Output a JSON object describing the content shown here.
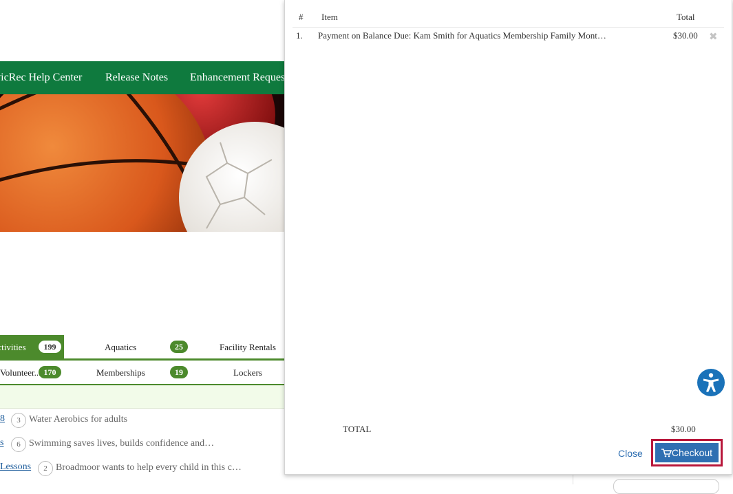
{
  "nav": {
    "items": [
      "CivicRec Help Center",
      "Release Notes",
      "Enhancement Requests"
    ]
  },
  "tabs": {
    "row1": [
      {
        "label": "Activities",
        "count": "199"
      },
      {
        "label": "Aquatics",
        "count": "25"
      },
      {
        "label": "Facility Rentals"
      }
    ],
    "row2": [
      {
        "label": "Volunteer...",
        "count": "170"
      },
      {
        "label": "Memberships",
        "count": "19"
      },
      {
        "label": "Lockers"
      }
    ]
  },
  "results": [
    {
      "link": "8",
      "count": "3",
      "desc": "Water Aerobics for adults"
    },
    {
      "link": "s",
      "count": "6",
      "desc": "Swimming saves lives, builds confidence and…"
    },
    {
      "link": "Lessons",
      "count": "2",
      "desc": "Broadmoor wants to help every child in this c…"
    }
  ],
  "cart": {
    "headers": {
      "num": "#",
      "item": "Item",
      "total": "Total"
    },
    "items": [
      {
        "num": "1.",
        "item": "Payment on Balance Due: Kam Smith for Aquatics Membership Family Mont…",
        "total": "$30.00"
      }
    ],
    "total_label": "TOTAL",
    "total_value": "$30.00",
    "close_label": "Close",
    "checkout_label": "Checkout"
  },
  "colors": {
    "nav_green": "#0f7a3e",
    "tab_green": "#4c8a2c",
    "primary_blue": "#2f6fb2",
    "focus_outline": "#b8173b",
    "accessibility_blue": "#1a72b9"
  },
  "icons": {
    "remove": "close-icon",
    "checkout": "cart-icon",
    "accessibility": "accessibility-icon"
  }
}
